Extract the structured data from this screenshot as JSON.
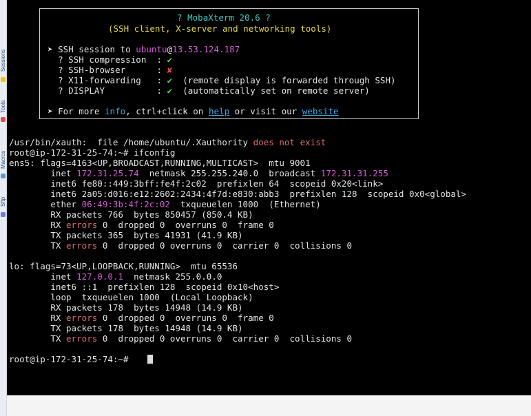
{
  "app": {
    "accent_color": "#3fa8e8",
    "terminal_bg": "#000000",
    "highlight_color": "#d45bd4",
    "error_color": "#e06b6b"
  },
  "sidebar": {
    "tabs": [
      {
        "label": "Sessions",
        "icon": "session-icon"
      },
      {
        "label": "Tools",
        "icon": "tools-icon"
      },
      {
        "label": "Macros",
        "icon": "macros-icon"
      },
      {
        "label": "Sftp",
        "icon": "sftp-icon"
      }
    ]
  },
  "banner": {
    "title": "? MobaXterm 20.6 ?",
    "subtitle": "(SSH client, X-server and networking tools)",
    "session_prefix": "➤ SSH session to ",
    "user": "ubuntu",
    "at": "@",
    "host": "13.53.124.187",
    "checks": [
      {
        "label": "  ? SSH compression  : ",
        "mark": "✔",
        "ok": true,
        "note": ""
      },
      {
        "label": "  ? SSH-browser      : ",
        "mark": "✘",
        "ok": false,
        "note": ""
      },
      {
        "label": "  ? X11-forwarding   : ",
        "mark": "✔",
        "ok": true,
        "note": "  (remote display is forwarded through SSH)"
      },
      {
        "label": "  ? DISPLAY          : ",
        "mark": "✔",
        "ok": true,
        "note": "  (automatically set on remote server)"
      }
    ],
    "more_prefix": "➤ For more ",
    "info": "info",
    "more_mid": ", ctrl+click on ",
    "help": "help",
    "more_or": " or visit our ",
    "website": "website"
  },
  "terminal": {
    "xauth_prefix": "/usr/bin/xauth:  file /home/ubuntu/.Xauthority ",
    "xauth_error": "does not exist",
    "prompt": "root@ip-172-31-25-74:~# ",
    "command": "ifconfig",
    "ens5_header": "ens5: flags=4163<UP,BROADCAST,RUNNING,MULTICAST>  mtu 9001",
    "ens5_inet_label": "        inet ",
    "ens5_inet": "172.31.25.74",
    "ens5_inet_mid": "  netmask 255.255.240.0  broadcast ",
    "ens5_broadcast": "172.31.31.255",
    "ens5_inet6_a": "        inet6 fe80::449:3bff:fe4f:2c02  prefixlen 64  scopeid 0x20<link>",
    "ens5_inet6_b": "        inet6 2a05:d016:e12:2602:2434:4f7d:e830:abb3  prefixlen 128  scopeid 0x0<global>",
    "ens5_ether_label": "        ether ",
    "ens5_ether": "06:49:3b:4f:2c:02",
    "ens5_ether_rest": "  txqueuelen 1000  (Ethernet)",
    "ens5_rx_packets": "        RX packets 766  bytes 850457 (850.4 KB)",
    "ens5_rx_err_prefix": "        RX ",
    "errors_word": "errors",
    "ens5_rx_err_rest": " 0  dropped 0  overruns 0  frame 0",
    "ens5_tx_packets": "        TX packets 365  bytes 41931 (41.9 KB)",
    "ens5_tx_err_prefix": "        TX ",
    "ens5_tx_err_rest": " 0  dropped 0 overruns 0  carrier 0  collisions 0",
    "lo_header": "lo: flags=73<UP,LOOPBACK,RUNNING>  mtu 65536",
    "lo_inet_label": "        inet ",
    "lo_inet": "127.0.0.1",
    "lo_inet_rest": "  netmask 255.0.0.0",
    "lo_inet6": "        inet6 ::1  prefixlen 128  scopeid 0x10<host>",
    "lo_loop": "        loop  txqueuelen 1000  (Local Loopback)",
    "lo_rx_packets": "        RX packets 178  bytes 14948 (14.9 KB)",
    "lo_rx_err_rest": " 0  dropped 0  overruns 0  frame 0",
    "lo_tx_packets": "        TX packets 178  bytes 14948 (14.9 KB)",
    "lo_tx_err_rest": " 0  dropped 0 overruns 0  carrier 0  collisions 0",
    "final_prompt": "root@ip-172-31-25-74:~# "
  }
}
